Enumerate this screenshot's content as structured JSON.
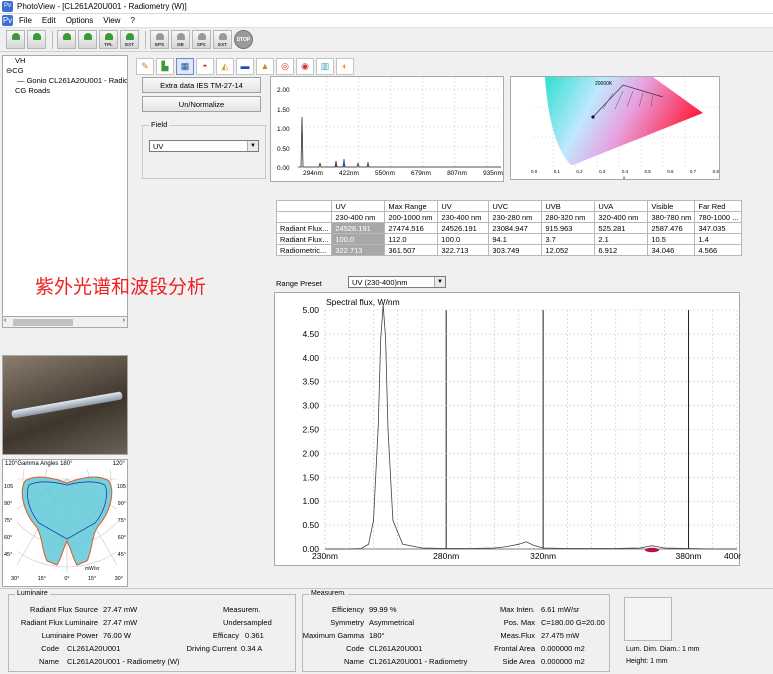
{
  "window": {
    "title": "PhotoView - [CL261A20U001 - Radiometry (W)]",
    "icon": "Pv"
  },
  "menu": [
    "File",
    "Edit",
    "Options",
    "View",
    "?"
  ],
  "toolbar": {
    "buttons": [
      "",
      "",
      "",
      "",
      "TPL",
      "EXT",
      "EPS",
      "DB",
      "SPC",
      "EXT"
    ],
    "stop_label": "STOP"
  },
  "tree": {
    "items": [
      "VH",
      "CG",
      "Gonio CL261A20U001 - Radiomet",
      "CG Roads"
    ]
  },
  "polar": {
    "title": "120°Gamma Angles  180°",
    "right_top": "120°",
    "left_labels": [
      "105",
      "90°",
      "75°",
      "60°",
      "45°",
      "30°"
    ],
    "right_labels": [
      "105",
      "90°",
      "75°",
      "60°",
      "45°"
    ],
    "bottom_labels": [
      "30°",
      "15°",
      "0°",
      "15°",
      "30°"
    ],
    "unit": "mW/sr"
  },
  "buttons": {
    "extra_data": "Extra data IES TM-27-14",
    "unnormalize": "Un/Normalize"
  },
  "field": {
    "label": "Field",
    "value": "UV"
  },
  "mini_spectrum": {
    "y_ticks": [
      "2.00",
      "1.50",
      "1.00",
      "0.50",
      "0.00"
    ],
    "x_ticks": [
      "294nm",
      "422nm",
      "550nm",
      "679nm",
      "807nm",
      "935nm"
    ]
  },
  "cie": {
    "label": "20000K",
    "x_ticks": [
      "0.0",
      "0.1",
      "0.2",
      "0.3",
      "0.4",
      "0.5",
      "0.6",
      "0.7",
      "0.8"
    ],
    "x_label": "x"
  },
  "table": {
    "headers": [
      "",
      "UV",
      "Max Range",
      "UV",
      "UVC",
      "UVB",
      "UVA",
      "Visible",
      "Far Red"
    ],
    "ranges": [
      "",
      "230-400 nm",
      "200-1000 nm",
      "230-400 nm",
      "230-280 nm",
      "280-320 nm",
      "320-400 nm",
      "380-780 nm",
      "780-1000 ..."
    ],
    "rows": [
      [
        "Radiant Flux...",
        "24526.191",
        "27474.516",
        "24526.191",
        "23084.947",
        "915.963",
        "525.281",
        "2587.476",
        "347.035"
      ],
      [
        "Radiant Flux...",
        "100.0",
        "112.0",
        "100.0",
        "94.1",
        "3.7",
        "2.1",
        "10.5",
        "1.4"
      ],
      [
        "Radiometric...",
        "322.713",
        "361.507",
        "322.713",
        "303.749",
        "12.052",
        "6.912",
        "34.046",
        "4.566"
      ]
    ]
  },
  "overlay_text": "紫外光谱和波段分析",
  "range_preset": {
    "label": "Range Preset",
    "value": "UV (230-400)nm"
  },
  "spectrum": {
    "title": "Spectral flux, W/nm",
    "y_ticks": [
      "5.00",
      "4.50",
      "4.00",
      "3.50",
      "3.00",
      "2.50",
      "2.00",
      "1.50",
      "1.00",
      "0.50",
      "0.00"
    ],
    "x_ticks": [
      "230nm",
      "280nm",
      "320nm",
      "380nm",
      "400nm"
    ]
  },
  "chart_data": {
    "type": "line",
    "title": "Spectral flux, W/nm",
    "xlabel": "",
    "ylabel": "",
    "xlim": [
      230,
      400
    ],
    "ylim": [
      0,
      5
    ],
    "x": [
      230,
      240,
      245,
      248,
      250,
      252,
      253,
      254,
      255,
      256,
      258,
      262,
      270,
      280,
      290,
      300,
      305,
      310,
      313,
      316,
      320,
      330,
      340,
      350,
      360,
      363,
      365,
      367,
      370,
      380,
      390,
      400
    ],
    "series": [
      {
        "name": "",
        "values": [
          0,
          0,
          0.01,
          0.1,
          0.6,
          2.6,
          4.4,
          5.1,
          4.4,
          2.5,
          0.6,
          0.1,
          0.02,
          0.01,
          0.01,
          0.02,
          0.05,
          0.1,
          0.15,
          0.08,
          0.02,
          0.01,
          0.01,
          0.01,
          0.02,
          0.05,
          0.07,
          0.05,
          0.02,
          0.01,
          0,
          0
        ]
      }
    ]
  },
  "luminaire": {
    "group_title": "Luminaire",
    "radiant_flux_source_label": "Radiant Flux Source",
    "radiant_flux_source": "27.47 mW",
    "radiant_flux_luminaire_label": "Radiant Flux Luminaire",
    "radiant_flux_luminaire": "27.47 mW",
    "luminaire_power_label": "Luminaire Power",
    "luminaire_power": "76.00 W",
    "code_label": "Code",
    "code": "CL261A20U001",
    "name_label": "Name",
    "name": "CL261A20U001 - Radiometry (W)",
    "measurem_label": "Measurem.",
    "undersampled": "Undersampled",
    "efficacy_label": "Efficacy",
    "efficacy": "0.361",
    "driving_current_label": "Driving Current",
    "driving_current": "0.34 A"
  },
  "measurem": {
    "group_title": "Measurem.",
    "efficiency_label": "Efficiency",
    "efficiency": "99.99 %",
    "symmetry_label": "Symmetry",
    "symmetry": "Asymmetrical",
    "max_gamma_label": "Maximum Gamma",
    "max_gamma": "180°",
    "code_label": "Code",
    "code": "CL261A20U001",
    "name_label": "Name",
    "name": "CL261A20U001 - Radiometry",
    "max_inten_label": "Max Inten.",
    "max_inten": "6.61 mW/sr",
    "pos_max_label": "Pos. Max",
    "pos_max": "C=180.00 G=20.00",
    "meas_flux_label": "Meas.Flux",
    "meas_flux": "27.475 mW",
    "frontal_area_label": "Frontal Area",
    "frontal_area": "0.000000 m2",
    "side_area_label": "Side Area",
    "side_area": "0.000000 m2"
  },
  "lum_dim": {
    "diam": "Lum. Dim. Diam.: 1 mm",
    "height": "Height: 1 mm"
  }
}
